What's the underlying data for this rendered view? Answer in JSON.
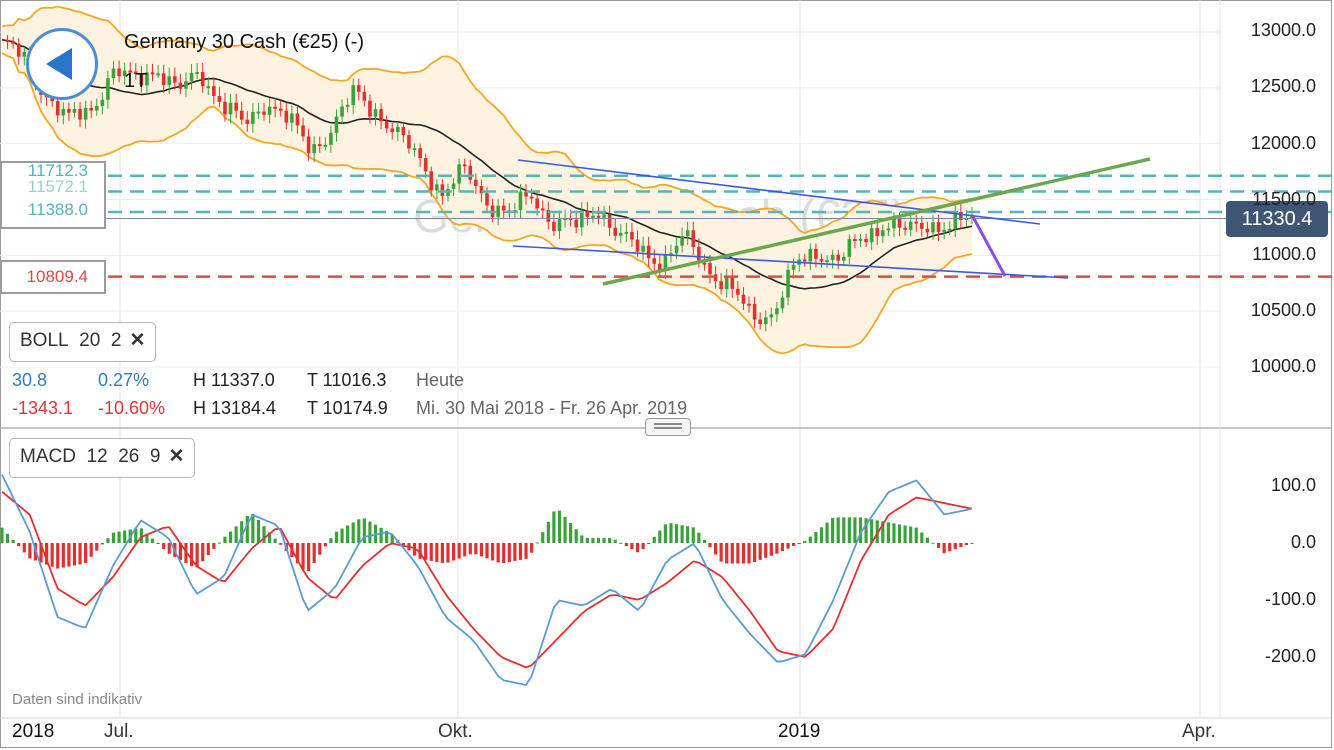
{
  "instrument": {
    "name": "Germany 30 Cash (€25) (-)",
    "timeframe": "1T",
    "watermark": "Germany 30 Cash (€25)"
  },
  "back_button": {
    "icon": "back-arrow-icon"
  },
  "levels": [
    {
      "label": "11712.3",
      "value": 11712.3,
      "color": "#56b5b5"
    },
    {
      "label": "11572.1",
      "value": 11572.1,
      "color": "#56b5b5"
    },
    {
      "label": "11388.0",
      "value": 11388.0,
      "color": "#56b5b5"
    },
    {
      "label": "10809.4",
      "value": 10809.4,
      "color": "#e04a4a"
    }
  ],
  "current_price": {
    "label": "11330.4",
    "value": 11330.4
  },
  "boll_indicator": {
    "name": "BOLL",
    "p1": "20",
    "p2": "2"
  },
  "macd_indicator": {
    "name": "MACD",
    "p1": "12",
    "p2": "26",
    "p3": "9"
  },
  "stats": {
    "row1": {
      "change": "30.8",
      "pct": "0.27%",
      "high": "H 11337.0",
      "low": "T 11016.3",
      "period": "Heute"
    },
    "row2": {
      "change": "-1343.1",
      "pct": "-10.60%",
      "high": "H 13184.4",
      "low": "T 10174.9",
      "period": "Mi. 30 Mai 2018 - Fr. 26 Apr. 2019"
    }
  },
  "footer_note": "Daten sind indikativ",
  "colors": {
    "up": "#3aa23a",
    "down": "#e03030",
    "band": "#f5a623",
    "sma": "#222222",
    "trend_blue": "#3a5be0",
    "trend_green": "#6aa84f",
    "macd": "#5b9bd5",
    "signal": "#e03030"
  },
  "chart_data": [
    {
      "type": "candlestick",
      "title": "Germany 30 Cash (€25) (-)",
      "y_ticks": [
        "13000.0",
        "12500.0",
        "12000.0",
        "11500.0",
        "11000.0",
        "10500.0",
        "10000.0"
      ],
      "ylim": [
        9900,
        13300
      ],
      "x_ticks": [
        "2018",
        "Jul.",
        "Okt.",
        "2019",
        "Apr."
      ],
      "close_path": [
        12900,
        12750,
        12450,
        12200,
        12300,
        12650,
        12550,
        12700,
        12450,
        12650,
        12350,
        12150,
        12400,
        12200,
        11950,
        12150,
        12450,
        12300,
        12050,
        11850,
        11550,
        11750,
        11500,
        11350,
        11550,
        11300,
        11250,
        11450,
        11150,
        11050,
        10950,
        11150,
        10900,
        10700,
        10450,
        10500,
        10900,
        11050,
        10950,
        11150,
        11300,
        11200,
        11300,
        11250,
        11330
      ],
      "overlays": [
        "Bollinger Bands (20, 2)",
        "SMA 20"
      ]
    },
    {
      "type": "macd",
      "y_ticks": [
        "100.0",
        "0.0",
        "-100.0",
        "-200.0"
      ],
      "ylim": [
        -250,
        120
      ],
      "series": [
        {
          "name": "MACD",
          "values": [
            120,
            20,
            -130,
            -150,
            -40,
            40,
            10,
            -90,
            -60,
            50,
            30,
            -120,
            -80,
            10,
            20,
            -40,
            -130,
            -170,
            -240,
            -250,
            -100,
            -110,
            -80,
            -120,
            -30,
            0,
            -100,
            -160,
            -210,
            -195,
            -100,
            20,
            90,
            110,
            50,
            60
          ]
        },
        {
          "name": "Signal",
          "values": [
            90,
            50,
            -80,
            -110,
            -60,
            10,
            30,
            -40,
            -70,
            -10,
            30,
            -60,
            -100,
            -40,
            0,
            -10,
            -90,
            -150,
            -200,
            -220,
            -170,
            -120,
            -90,
            -100,
            -70,
            -30,
            -60,
            -120,
            -190,
            -200,
            -150,
            -30,
            50,
            80,
            70,
            60
          ]
        }
      ]
    }
  ]
}
